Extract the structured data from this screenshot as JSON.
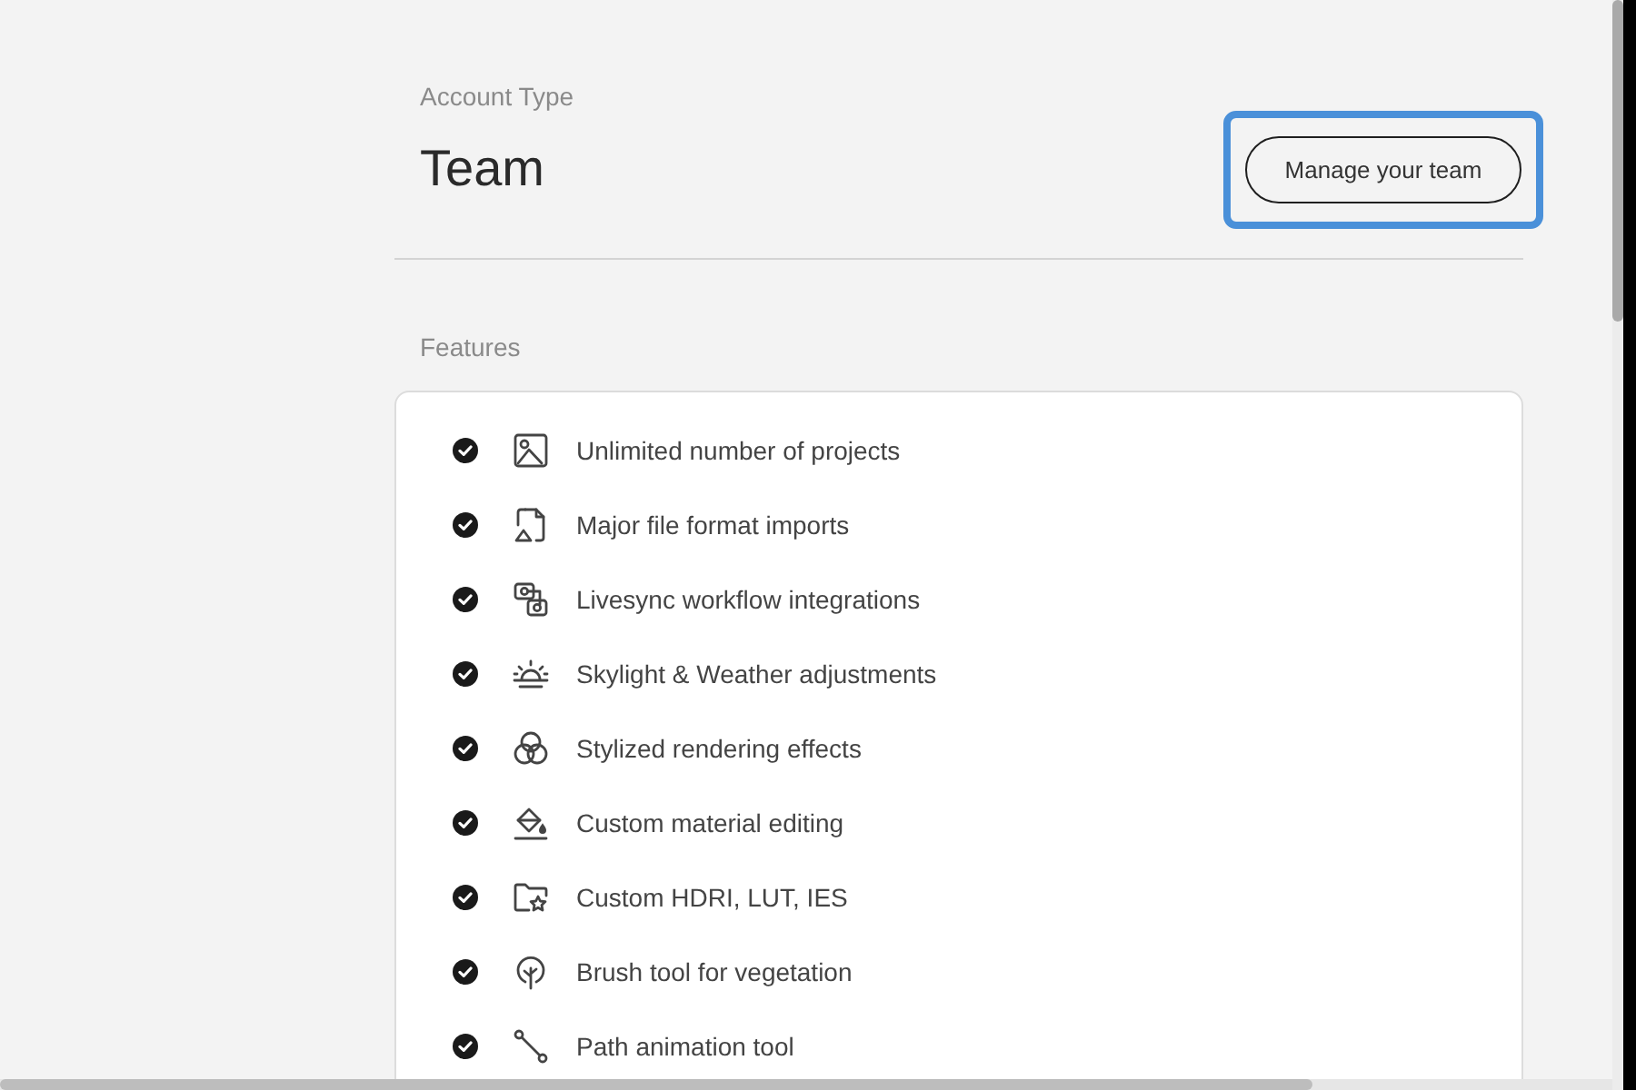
{
  "header": {
    "label": "Account Type",
    "account_type": "Team",
    "button": {
      "label": "Manage your team",
      "focused": true
    }
  },
  "features": {
    "title": "Features",
    "items": [
      {
        "label": "Unlimited number of projects",
        "checked": true
      },
      {
        "label": "Major file format imports",
        "checked": true
      },
      {
        "label": "Livesync workflow integrations",
        "checked": true
      },
      {
        "label": "Skylight & Weather adjustments",
        "checked": true
      },
      {
        "label": "Stylized rendering effects",
        "checked": true
      },
      {
        "label": "Custom material editing",
        "checked": true
      },
      {
        "label": "Custom HDRI, LUT, IES",
        "checked": true
      },
      {
        "label": "Brush tool for vegetation",
        "checked": true
      },
      {
        "label": "Path animation tool",
        "checked": true
      }
    ]
  }
}
